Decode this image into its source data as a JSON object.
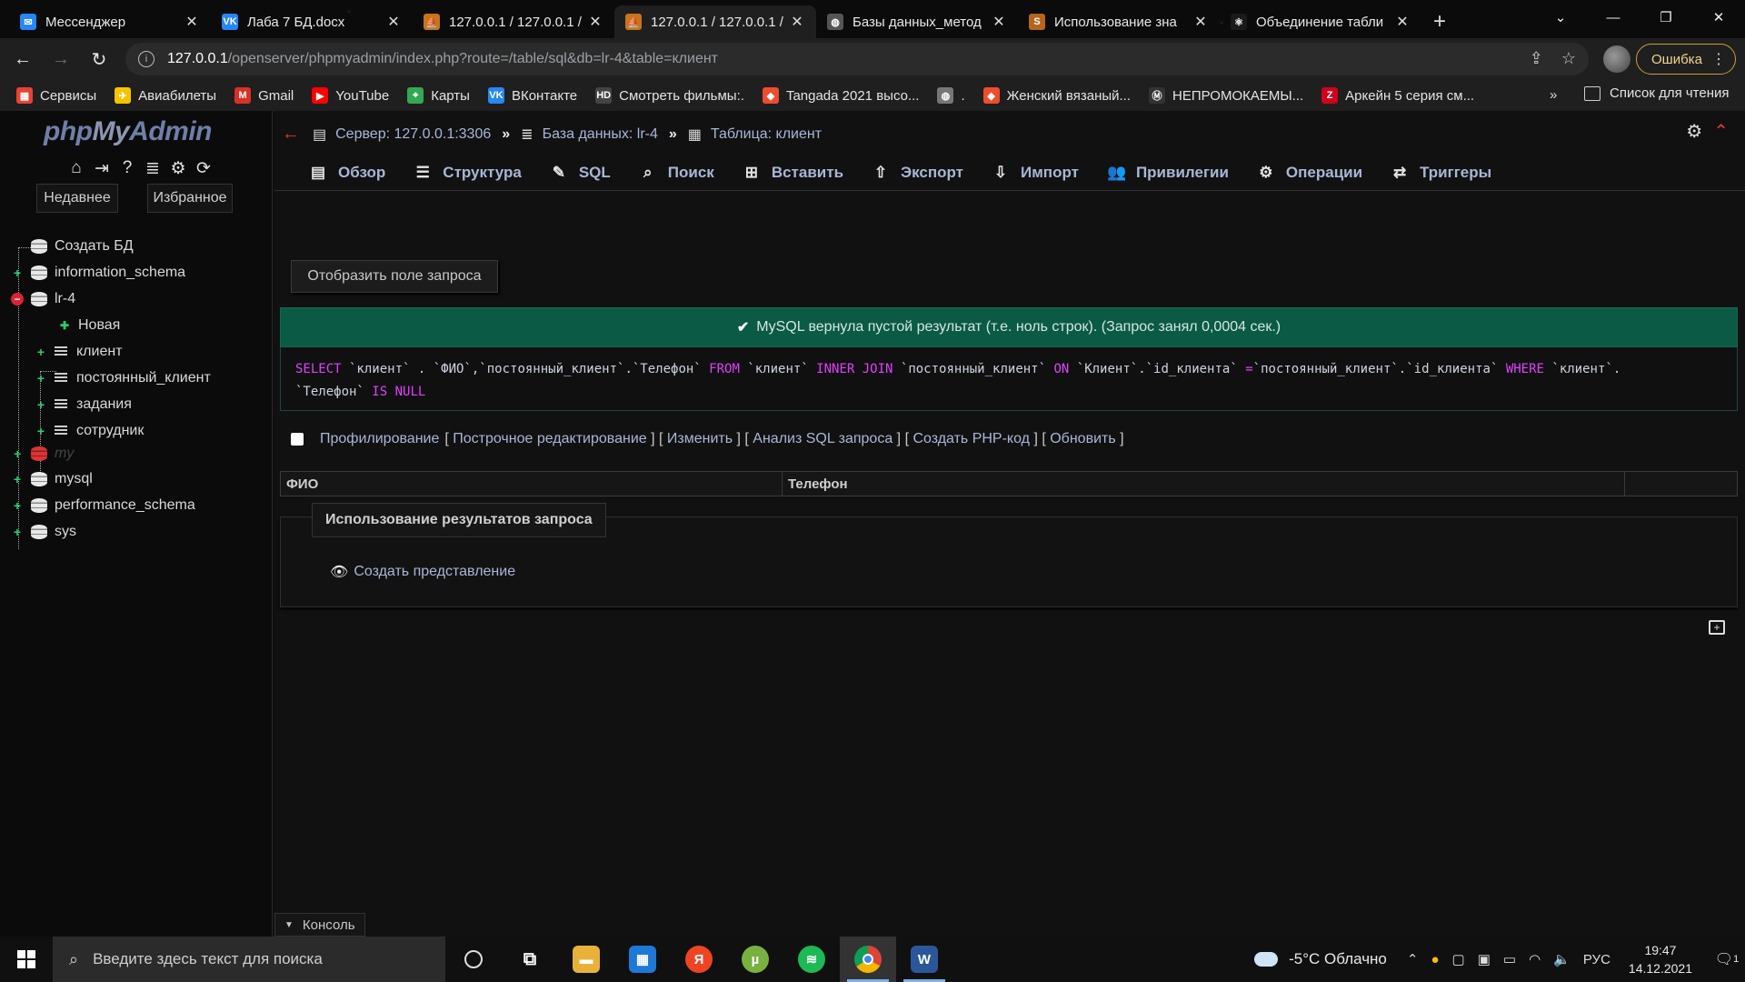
{
  "browser": {
    "tabs": [
      {
        "label": "Мессенджер",
        "icon": "vk-messenger-icon",
        "color": "#2787f5",
        "glyph": "✉",
        "active": false
      },
      {
        "label": "Лаба 7 БД.docx",
        "icon": "vk-icon",
        "color": "#2787f5",
        "glyph": "VK",
        "active": false
      },
      {
        "label": "127.0.0.1 / 127.0.0.1 /",
        "icon": "phpmyadmin-icon",
        "color": "#c8741a",
        "glyph": "⛵",
        "active": false
      },
      {
        "label": "127.0.0.1 / 127.0.0.1 /",
        "icon": "phpmyadmin-icon",
        "color": "#c8741a",
        "glyph": "⛵",
        "active": true
      },
      {
        "label": "Базы данных_метод",
        "icon": "globe-icon",
        "color": "#555555",
        "glyph": "◍",
        "active": false
      },
      {
        "label": "Использование зна",
        "icon": "site-s-icon",
        "color": "#b5651d",
        "glyph": "S",
        "active": false
      },
      {
        "label": "Объединение табли",
        "icon": "react-icon",
        "color": "#1a1a1a",
        "glyph": "⚛",
        "active": false
      }
    ],
    "address": {
      "host": "127.0.0.1",
      "path": "/openserver/phpmyadmin/index.php?route=/table/sql&db=lr-4&table=клиент"
    },
    "error_button": "Ошибка",
    "bookmarks": [
      {
        "label": "Сервисы",
        "icon": "apps-grid-icon",
        "color": "#e94235",
        "glyph": "▦"
      },
      {
        "label": "Авиабилеты",
        "icon": "plane-icon",
        "color": "#f5c400",
        "glyph": "✈"
      },
      {
        "label": "Gmail",
        "icon": "gmail-icon",
        "color": "#d93025",
        "glyph": "M"
      },
      {
        "label": "YouTube",
        "icon": "youtube-icon",
        "color": "#ff0000",
        "glyph": "▶"
      },
      {
        "label": "Карты",
        "icon": "maps-pin-icon",
        "color": "#34a853",
        "glyph": "⌖"
      },
      {
        "label": "ВКонтакте",
        "icon": "vk-icon",
        "color": "#2787f5",
        "glyph": "VK"
      },
      {
        "label": "Смотреть фильмы:.",
        "icon": "hd-icon",
        "color": "#444444",
        "glyph": "HD"
      },
      {
        "label": "Tangada 2021 высо...",
        "icon": "shop-icon",
        "color": "#ee4d2d",
        "glyph": "◆"
      },
      {
        "label": ".",
        "icon": "globe-icon",
        "color": "#777777",
        "glyph": "◍"
      },
      {
        "label": "Женский вязаный...",
        "icon": "shop-icon",
        "color": "#ee4d2d",
        "glyph": "◆"
      },
      {
        "label": "НЕПРОМОКАЕМЫ...",
        "icon": "brand-icon",
        "color": "#333333",
        "glyph": "Ⓜ"
      },
      {
        "label": "Аркейн 5 серия см...",
        "icon": "z-icon",
        "color": "#d0021b",
        "glyph": "Z"
      }
    ],
    "reading_list": "Список для чтения"
  },
  "pma": {
    "logo": {
      "php": "php",
      "my": "My",
      "admin": "Admin"
    },
    "recent": "Недавнее",
    "favorites": "Избранное",
    "tree": {
      "create_db": "Создать БД",
      "information_schema": "information_schema",
      "lr4": "lr-4",
      "new": "Новая",
      "t1": "клиент",
      "t2": "постоянный_клиент",
      "t3": "задания",
      "t4": "сотрудник",
      "my": "my",
      "mysql": "mysql",
      "performance_schema": "performance_schema",
      "sys": "sys"
    },
    "breadcrumb": {
      "server": "Сервер: 127.0.0.1:3306",
      "database": "База данных: lr-4",
      "table": "Таблица: клиент"
    },
    "menu": [
      {
        "label": "Обзор",
        "icon": "browse-icon",
        "glyph": "▤"
      },
      {
        "label": "Структура",
        "icon": "structure-icon",
        "glyph": "☰"
      },
      {
        "label": "SQL",
        "icon": "sql-icon",
        "glyph": "✎"
      },
      {
        "label": "Поиск",
        "icon": "search-icon",
        "glyph": "⌕"
      },
      {
        "label": "Вставить",
        "icon": "insert-icon",
        "glyph": "⊞"
      },
      {
        "label": "Экспорт",
        "icon": "export-icon",
        "glyph": "⇧"
      },
      {
        "label": "Импорт",
        "icon": "import-icon",
        "glyph": "⇩"
      },
      {
        "label": "Привилегии",
        "icon": "users-icon",
        "glyph": "👥"
      },
      {
        "label": "Операции",
        "icon": "gear-icon",
        "glyph": "⚙"
      },
      {
        "label": "Триггеры",
        "icon": "shuffle-icon",
        "glyph": "⇄"
      }
    ],
    "show_query_button": "Отобразить поле запроса",
    "success_message": "MySQL вернула пустой результат (т.е. ноль строк). (Запрос занял 0,0004 сек.)",
    "sql": {
      "k_select": "SELECT",
      "p1": " `клиент` . `ФИО`,`постоянный_клиент`.`Телефон` ",
      "k_from": "FROM",
      "p2": " `клиент` ",
      "k_join": "INNER JOIN",
      "p3": " `постоянный_клиент` ",
      "k_on": "ON",
      "p4": " `Клиент`.`id_клиента` ",
      "k_eq": "=",
      "p5": "`постоянный_клиент`.`id_клиента` ",
      "k_where": "WHERE",
      "p6": " `клиент`.",
      "p7": "`Телефон` ",
      "k_isnull": "IS NULL"
    },
    "profiling": {
      "label": "Профилирование",
      "links": [
        "Построчное редактирование",
        "Изменить",
        "Анализ SQL запроса",
        "Создать PHP-код",
        "Обновить"
      ]
    },
    "columns": [
      "ФИО",
      "Телефон"
    ],
    "query_results_legend": "Использование результатов запроса",
    "create_view": "Создать представление",
    "console": "Консоль"
  },
  "taskbar": {
    "search_placeholder": "Введите здесь текст для поиска",
    "weather": "-5°C  Облачно",
    "lang": "РУС",
    "time": "19:47",
    "date": "14.12.2021",
    "notifications": "1"
  }
}
